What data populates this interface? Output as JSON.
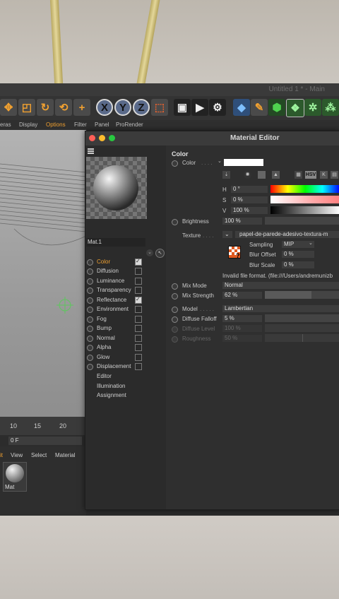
{
  "host": {
    "window_title": "Untitled 1 * - Main",
    "menu": [
      "eras",
      "Display",
      "Options",
      "Filter",
      "Panel",
      "ProRender"
    ],
    "timeline_ticks": [
      "10",
      "15",
      "20"
    ],
    "frame_field": "0 F",
    "material_manager_menu": [
      "it",
      "View",
      "Select",
      "Material"
    ],
    "material_thumb_label": "Mat"
  },
  "editor": {
    "title": "Material Editor",
    "material_name": "Mat.1",
    "channels": [
      {
        "label": "Color",
        "checked": true,
        "active": true
      },
      {
        "label": "Diffusion",
        "checked": false
      },
      {
        "label": "Luminance",
        "checked": false
      },
      {
        "label": "Transparency",
        "checked": false
      },
      {
        "label": "Reflectance",
        "checked": true
      },
      {
        "label": "Environment",
        "checked": false
      },
      {
        "label": "Fog",
        "checked": false
      },
      {
        "label": "Bump",
        "checked": false
      },
      {
        "label": "Normal",
        "checked": false
      },
      {
        "label": "Alpha",
        "checked": false
      },
      {
        "label": "Glow",
        "checked": false
      },
      {
        "label": "Displacement",
        "checked": false
      }
    ],
    "extra_items": [
      "Editor",
      "Illumination",
      "Assignment"
    ],
    "section_title": "Color",
    "color_label": "Color",
    "h_label": "H",
    "h_value": "0 °",
    "s_label": "S",
    "s_value": "0 %",
    "v_label": "V",
    "v_value": "100 %",
    "hsv_btn": "HSV",
    "k_btn": "K",
    "brightness_label": "Brightness",
    "brightness_value": "100 %",
    "texture_label": "Texture",
    "texture_value": "papel-de-parede-adesivo-textura-m",
    "sampling_label": "Sampling",
    "sampling_value": "MIP",
    "blur_offset_label": "Blur Offset",
    "blur_offset_value": "0 %",
    "blur_scale_label": "Blur Scale",
    "blur_scale_value": "0 %",
    "invalid_msg": "Invalid file format. (file:///Users/andremunizb",
    "mix_mode_label": "Mix Mode",
    "mix_mode_value": "Normal",
    "mix_strength_label": "Mix Strength",
    "mix_strength_value": "62 %",
    "mix_strength_level": 0.62,
    "model_label": "Model",
    "model_value": "Lambertian",
    "diffuse_falloff_label": "Diffuse Falloff",
    "diffuse_falloff_value": "5 %",
    "diffuse_level_label": "Diffuse Level",
    "diffuse_level_value": "100 %",
    "roughness_label": "Roughness",
    "roughness_value": "50 %"
  }
}
